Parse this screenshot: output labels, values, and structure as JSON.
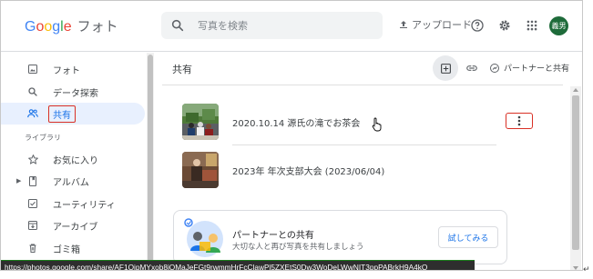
{
  "header": {
    "logo_google": [
      "G",
      "o",
      "o",
      "g",
      "l",
      "e"
    ],
    "product_name": "フォト",
    "search_placeholder": "写真を検索",
    "upload_label": "アップロード",
    "avatar_text": "義男",
    "icons": [
      "search-icon",
      "upload-icon",
      "help-icon",
      "settings-icon",
      "apps-grid-icon"
    ]
  },
  "sidebar": {
    "items": [
      {
        "label": "フォト",
        "icon": "photo-icon"
      },
      {
        "label": "データ探索",
        "icon": "search-icon"
      },
      {
        "label": "共有",
        "icon": "people-icon",
        "active": true
      }
    ],
    "library_label": "ライブラリ",
    "library_items": [
      {
        "label": "お気に入り",
        "icon": "star-icon"
      },
      {
        "label": "アルバム",
        "icon": "album-icon"
      },
      {
        "label": "ユーティリティ",
        "icon": "utilities-icon"
      },
      {
        "label": "アーカイブ",
        "icon": "archive-icon"
      },
      {
        "label": "ゴミ箱",
        "icon": "trash-icon"
      }
    ]
  },
  "main": {
    "title": "共有",
    "partner_share_label": "パートナーと共有",
    "albums": [
      {
        "title": "2020.10.14 源氏の滝でお茶会"
      },
      {
        "title": "2023年 年次支部大会 (2023/06/04)"
      }
    ],
    "partner_card": {
      "title": "パートナーとの共有",
      "subtitle": "大切な人と再び写真を共有しましょう",
      "button": "試してみる"
    }
  },
  "status_bar": {
    "url": "https://photos.google.com/share/AF1QipMYxob8iQMaJeFGt9rwmmHrFcClawPl5ZXEtS0Dw3WoDeLWwNIT3ppPABrkH9A4kQ"
  },
  "colors": {
    "accent": "#1a73e8",
    "highlight_border": "#d93025",
    "active_bg": "#e8f0fe"
  }
}
